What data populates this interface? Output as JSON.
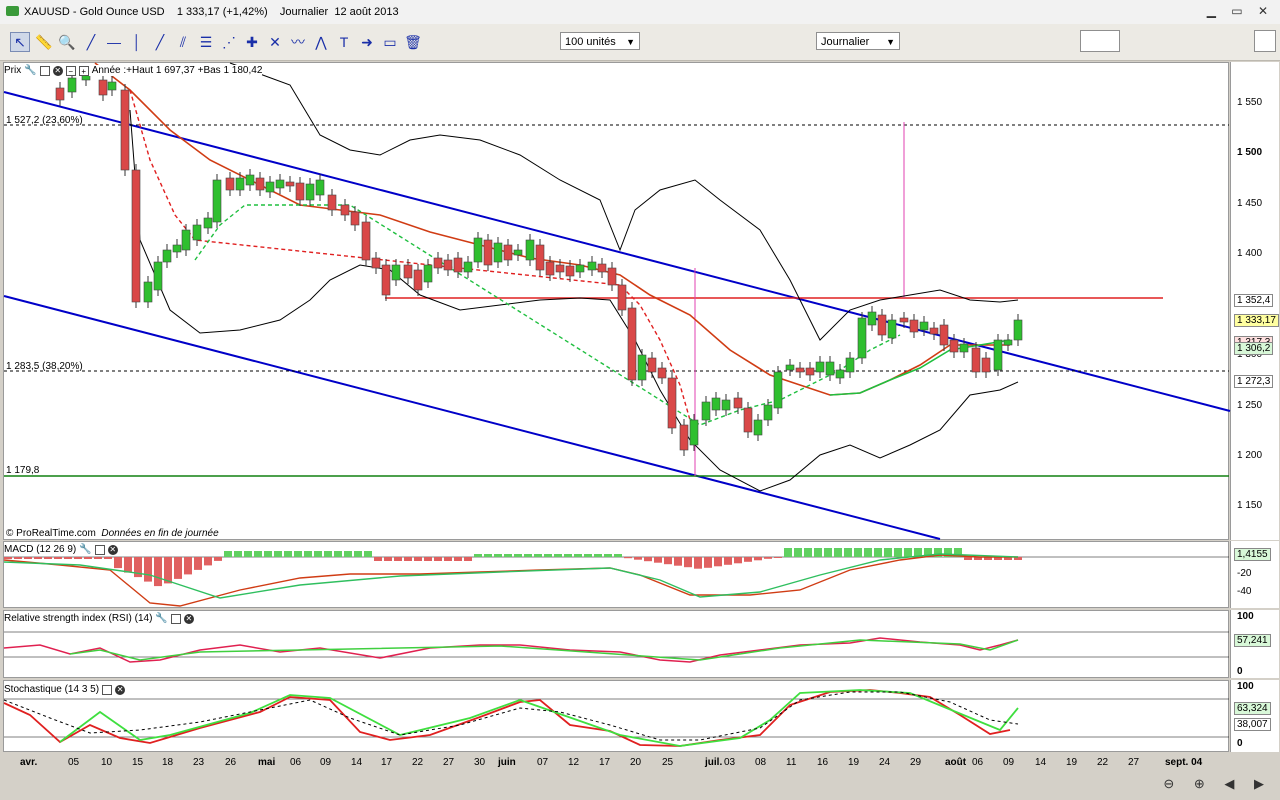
{
  "window": {
    "title": "XAUUSD - Gold Ounce USD",
    "price": "1 333,17 (+1,42%)",
    "period": "Journalier",
    "date": "12 août 2013"
  },
  "toolbar": {
    "units": "100 unités",
    "timeframe": "Journalier"
  },
  "price_panel": {
    "label": "Prix",
    "info": "Année :+Haut 1 697,37 +Bas 1 180,42",
    "fib_top": "1 527,2 (23,60%)",
    "fib_mid": "1 283,5 (38,20%)",
    "support": "1 179,8",
    "source": "© ProRealTime.com",
    "source_note": "Données en fin de journée",
    "ticks": [
      "1 550",
      "1 500",
      "1 450",
      "1 400",
      "1 350",
      "1 300",
      "1 250",
      "1 200",
      "1 150"
    ],
    "tags": {
      "t1": "1 352,4",
      "t2": "1 333,17",
      "t3": "1 317,3",
      "t4": "1 306,2",
      "t5": "1 272,3"
    }
  },
  "macd": {
    "label": "MACD (12 26 9)",
    "value": "1,4155",
    "ticks": [
      "-20",
      "-40"
    ]
  },
  "rsi": {
    "label": "Relative strength index (RSI) (14)",
    "value": "57,241",
    "ticks": [
      "100",
      "0"
    ]
  },
  "stoch": {
    "label": "Stochastique (14 3 5)",
    "value1": "63,324",
    "value2": "38,007",
    "ticks": [
      "100",
      "0"
    ]
  },
  "xaxis": [
    "avr.",
    "05",
    "10",
    "15",
    "18",
    "23",
    "26",
    "mai",
    "06",
    "09",
    "14",
    "17",
    "22",
    "27",
    "30",
    "juin",
    "07",
    "12",
    "17",
    "20",
    "25",
    "juil.",
    "03",
    "08",
    "11",
    "16",
    "19",
    "24",
    "29",
    "août",
    "06",
    "09",
    "14",
    "19",
    "22",
    "27",
    "sept. 04"
  ],
  "colors": {
    "up": "#2fbf2f",
    "down": "#d94848",
    "channel": "#0000c8",
    "ma": "#d03c14",
    "band": "#000000",
    "support": "#108010",
    "resistance": "#e02020",
    "fib": "#000000",
    "pink": "#e040b0"
  },
  "chart_data": {
    "type": "candlestick",
    "title": "XAUUSD - Gold Ounce USD",
    "ylim": [
      1125,
      1575
    ],
    "candles_sample": [
      {
        "x": "16",
        "o": 1340,
        "c": 1376,
        "h": 1386,
        "l": 1325
      },
      {
        "x": "26",
        "o": 1455,
        "c": 1476,
        "h": 1485,
        "l": 1440
      },
      {
        "x": "juin",
        "o": 1410,
        "c": 1394,
        "h": 1418,
        "l": 1380
      },
      {
        "x": "20",
        "o": 1350,
        "c": 1275,
        "h": 1353,
        "l": 1270
      },
      {
        "x": "25",
        "o": 1230,
        "c": 1212,
        "h": 1262,
        "l": 1195
      },
      {
        "x": "08",
        "o": 1230,
        "c": 1258,
        "h": 1262,
        "l": 1205
      },
      {
        "x": "19",
        "o": 1300,
        "c": 1340,
        "h": 1346,
        "l": 1295
      },
      {
        "x": "09",
        "o": 1312,
        "c": 1333,
        "h": 1345,
        "l": 1305
      }
    ],
    "levels": {
      "fib_23_6": 1527.2,
      "fib_38_2": 1283.5,
      "support": 1179.8,
      "resistance": 1352.4
    }
  }
}
